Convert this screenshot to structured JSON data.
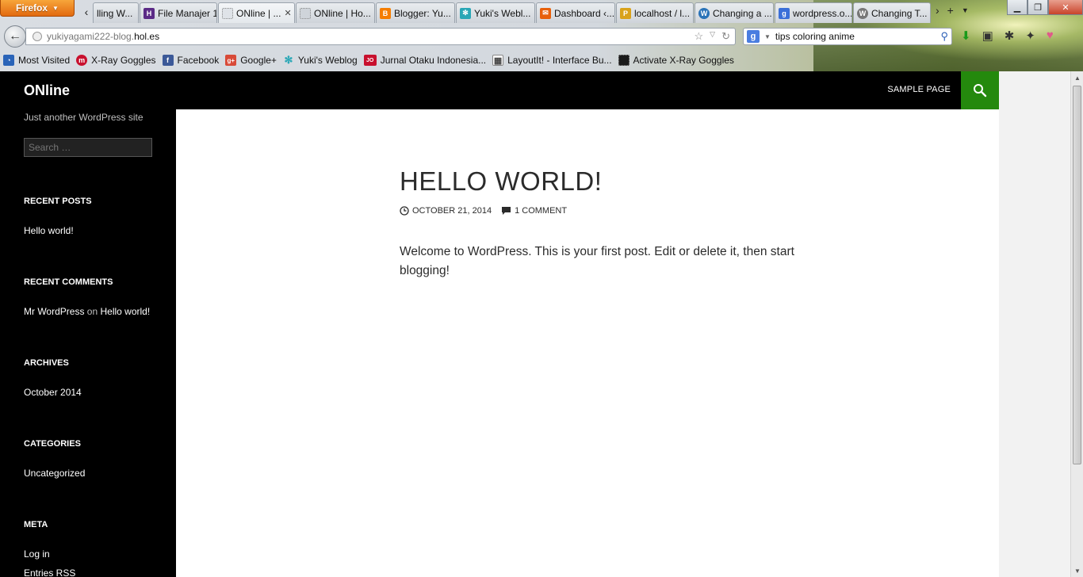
{
  "browser": {
    "app_button": "Firefox",
    "tabs": [
      {
        "label": "lling W...",
        "fav": "",
        "fav_color": "#d8dde2"
      },
      {
        "label": "File Manajer 1",
        "fav": "H",
        "fav_color": "#5b2a86"
      },
      {
        "label": "ONline | ...",
        "fav": "",
        "fav_color": "#dfe3e8",
        "active": true
      },
      {
        "label": "ONline | Ho...",
        "fav": "",
        "fav_color": "#cfd4da"
      },
      {
        "label": "Blogger: Yu...",
        "fav": "B",
        "fav_color": "#f57d00"
      },
      {
        "label": "Yuki's Webl...",
        "fav": "✻",
        "fav_color": "#2aa7b6"
      },
      {
        "label": "Dashboard ‹...",
        "fav": "✉",
        "fav_color": "#e8600b"
      },
      {
        "label": "localhost / l...",
        "fav": "P",
        "fav_color": "#d9a21b"
      },
      {
        "label": "Changing a ...",
        "fav": "W",
        "fav_color": "#2a73b8"
      },
      {
        "label": "wordpress.o...",
        "fav": "g",
        "fav_color": "#3b6fd8"
      },
      {
        "label": "Changing T...",
        "fav": "W",
        "fav_color": "#777777"
      }
    ],
    "url_host": "yukiyagami222-blog.",
    "url_domain": "hol.es",
    "search_engine_icon": "g",
    "search_query": "tips coloring anime",
    "bookmarks": [
      {
        "label": "Most Visited",
        "icon": "◔",
        "color": "#2a64b8"
      },
      {
        "label": "X-Ray Goggles",
        "icon": "m",
        "color": "#c8102e"
      },
      {
        "label": "Facebook",
        "icon": "f",
        "color": "#3b5998"
      },
      {
        "label": "Google+",
        "icon": "g+",
        "color": "#d84a38"
      },
      {
        "label": "Yuki's Weblog",
        "icon": "✻",
        "color": "#2aa7b6"
      },
      {
        "label": "Jurnal Otaku Indonesia...",
        "icon": "JO",
        "color": "#c8102e"
      },
      {
        "label": "LayoutIt! - Interface Bu...",
        "icon": "▦",
        "color": "#444444"
      },
      {
        "label": "Activate X-Ray Goggles",
        "icon": "",
        "color": "#1a1a1a"
      }
    ]
  },
  "site": {
    "title": "ONline",
    "tagline": "Just another WordPress site",
    "nav_item": "SAMPLE PAGE",
    "accent_color": "#24890d",
    "search_placeholder": "Search …"
  },
  "widgets": {
    "recent_posts_title": "RECENT POSTS",
    "recent_post": "Hello world!",
    "recent_comments_title": "RECENT COMMENTS",
    "comment_author": "Mr WordPress",
    "comment_on": "on",
    "comment_post": "Hello world!",
    "archives_title": "ARCHIVES",
    "archive": "October 2014",
    "categories_title": "CATEGORIES",
    "category": "Uncategorized",
    "meta_title": "META",
    "meta_login": "Log in",
    "meta_rss": "Entries RSS"
  },
  "post": {
    "title": "HELLO WORLD!",
    "date": "OCTOBER 21, 2014",
    "comments": "1 COMMENT",
    "body": "Welcome to WordPress. This is your first post. Edit or delete it, then start blogging!"
  }
}
